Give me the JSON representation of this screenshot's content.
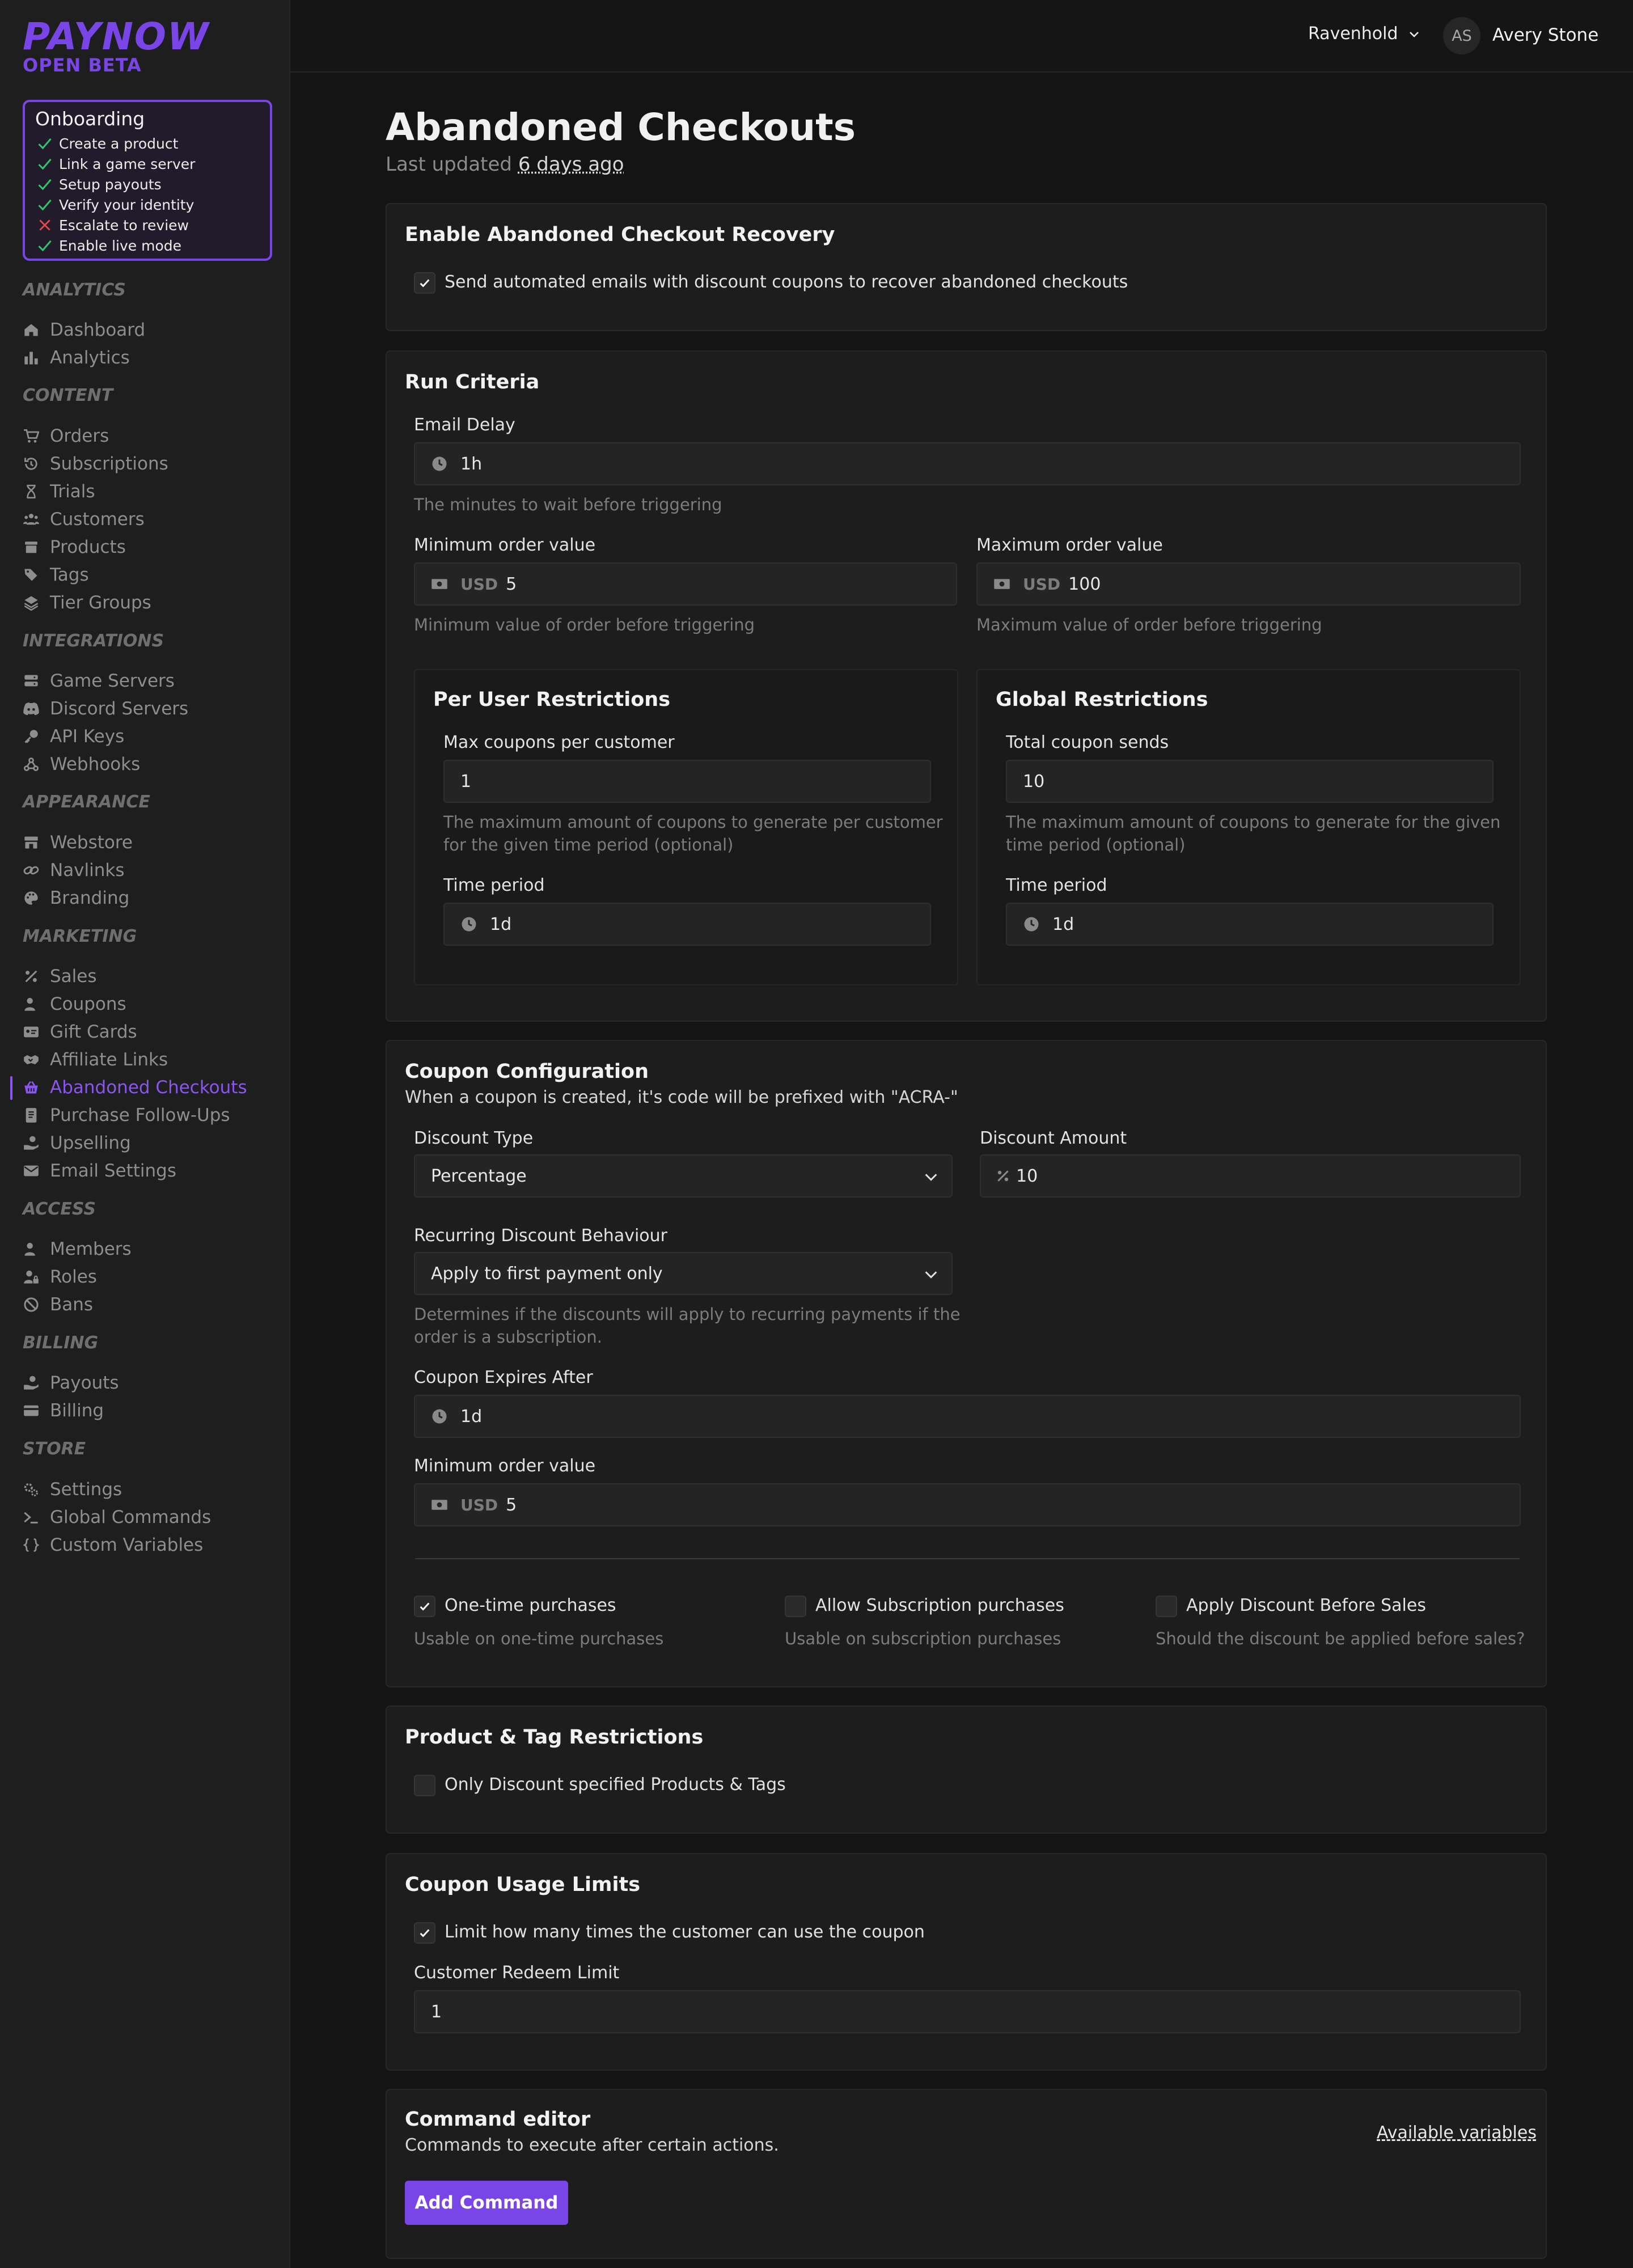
{
  "brand": {
    "logo": "PAYNOW",
    "badge": "OPEN BETA"
  },
  "onboarding": {
    "title": "Onboarding",
    "steps": [
      {
        "label": "Create a product",
        "status": "done"
      },
      {
        "label": "Link a game server",
        "status": "done"
      },
      {
        "label": "Setup payouts",
        "status": "done"
      },
      {
        "label": "Verify your identity",
        "status": "done"
      },
      {
        "label": "Escalate to review",
        "status": "failed"
      },
      {
        "label": "Enable live mode",
        "status": "done"
      }
    ]
  },
  "sidebar": {
    "sections": {
      "analytics": "ANALYTICS",
      "content": "CONTENT",
      "integrations": "INTEGRATIONS",
      "appearance": "APPEARANCE",
      "marketing": "MARKETING",
      "access": "ACCESS",
      "billing": "BILLING",
      "store": "STORE"
    },
    "items": {
      "dashboard": "Dashboard",
      "analytics": "Analytics",
      "orders": "Orders",
      "subscriptions": "Subscriptions",
      "trials": "Trials",
      "customers": "Customers",
      "products": "Products",
      "tags": "Tags",
      "tier_groups": "Tier Groups",
      "game_servers": "Game Servers",
      "discord_servers": "Discord Servers",
      "api_keys": "API Keys",
      "webhooks": "Webhooks",
      "webstore": "Webstore",
      "navlinks": "Navlinks",
      "branding": "Branding",
      "sales": "Sales",
      "coupons": "Coupons",
      "gift_cards": "Gift Cards",
      "affiliate_links": "Affiliate Links",
      "abandoned_checkouts": "Abandoned Checkouts",
      "purchase_followups": "Purchase Follow-Ups",
      "upselling": "Upselling",
      "email_settings": "Email Settings",
      "members": "Members",
      "roles": "Roles",
      "bans": "Bans",
      "payouts": "Payouts",
      "billing": "Billing",
      "settings": "Settings",
      "global_commands": "Global Commands",
      "custom_variables": "Custom Variables"
    },
    "active": "abandoned_checkouts",
    "accent": "#8a55f0"
  },
  "topbar": {
    "store": "Ravenhold",
    "avatar_initials": "AS",
    "user_name": "Avery Stone"
  },
  "page": {
    "title": "Abandoned Checkouts",
    "updated_prefix": "Last updated",
    "updated_value": "6 days ago"
  },
  "enable_card": {
    "title": "Enable Abandoned Checkout Recovery",
    "checkbox_label": "Send automated emails with discount coupons to recover abandoned checkouts",
    "checked": true
  },
  "run_criteria": {
    "title": "Run Criteria",
    "email_delay": {
      "label": "Email Delay",
      "value": "1h",
      "help": "The minutes to wait before triggering"
    },
    "min_order": {
      "label": "Minimum order value",
      "currency": "USD",
      "value": "5",
      "help": "Minimum value of order before triggering"
    },
    "max_order": {
      "label": "Maximum order value",
      "currency": "USD",
      "value": "100",
      "help": "Maximum value of order before triggering"
    },
    "per_user": {
      "title": "Per User Restrictions",
      "max_label": "Max coupons per customer",
      "max_value": "1",
      "help_line1": "The maximum amount of coupons to generate per customer",
      "help_line2": "for the given time period (optional)",
      "period_label": "Time period",
      "period_value": "1d"
    },
    "global": {
      "title": "Global Restrictions",
      "total_label": "Total coupon sends",
      "total_value": "10",
      "help_line1": "The maximum amount of coupons to generate for the given",
      "help_line2": "time period (optional)",
      "period_label": "Time period",
      "period_value": "1d"
    }
  },
  "coupon_config": {
    "title": "Coupon Configuration",
    "subtitle": "When a coupon is created, it's code will be prefixed with \"ACRA-\"",
    "discount_type": {
      "label": "Discount Type",
      "value": "Percentage"
    },
    "discount_amount": {
      "label": "Discount Amount",
      "value": "10"
    },
    "recurring": {
      "label": "Recurring Discount Behaviour",
      "value": "Apply to first payment only",
      "help_line1": "Determines if the discounts will apply to recurring payments if the",
      "help_line2": "order is a subscription."
    },
    "expires": {
      "label": "Coupon Expires After",
      "value": "1d"
    },
    "min_order": {
      "label": "Minimum order value",
      "currency": "USD",
      "value": "5"
    },
    "options": [
      {
        "label": "One-time purchases",
        "help": "Usable on one-time purchases",
        "checked": true
      },
      {
        "label": "Allow Subscription purchases",
        "help": "Usable on subscription purchases",
        "checked": false
      },
      {
        "label": "Apply Discount Before Sales",
        "help": "Should the discount be applied before sales?",
        "checked": false
      }
    ]
  },
  "product_tag": {
    "title": "Product & Tag Restrictions",
    "checkbox_label": "Only Discount specified Products & Tags",
    "checked": false
  },
  "usage_limits": {
    "title": "Coupon Usage Limits",
    "checkbox_label": "Limit how many times the customer can use the coupon",
    "checked": true,
    "redeem_label": "Customer Redeem Limit",
    "redeem_value": "1"
  },
  "command_editor": {
    "title": "Command editor",
    "subtitle": "Commands to execute after certain actions.",
    "vars_link": "Available variables",
    "add_button": "Add Command"
  }
}
